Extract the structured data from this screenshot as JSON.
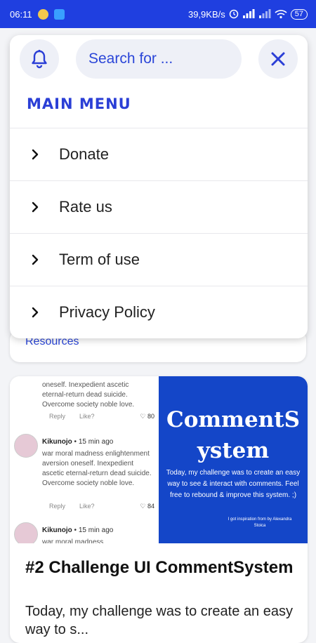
{
  "status_bar": {
    "time": "06:11",
    "network_speed": "39,9KB/s",
    "battery": "57",
    "icons": [
      "app-notification-icon",
      "download-icon",
      "alarm-icon",
      "signal-icon",
      "signal-icon",
      "wifi-icon",
      "battery-icon"
    ]
  },
  "header": {
    "bell_icon": "bell-icon",
    "search": {
      "placeholder": "Search for ..."
    },
    "close_icon": "close-icon"
  },
  "menu": {
    "title": "MAIN MENU",
    "items": [
      {
        "label": "Donate",
        "icon": "chevron-right-icon"
      },
      {
        "label": "Rate us",
        "icon": "chevron-right-icon"
      },
      {
        "label": "Term of use",
        "icon": "chevron-right-icon"
      },
      {
        "label": "Privacy Policy",
        "icon": "chevron-right-icon"
      }
    ]
  },
  "background": {
    "resources_link": "Resources"
  },
  "post": {
    "image": {
      "comments": [
        {
          "text": "oneself. Inexpedient ascetic eternal-return dead suicide. Overcome society noble love.",
          "reply": "Reply",
          "like": "Like?",
          "likes": "80"
        },
        {
          "author": "Kikunojo",
          "time": "15 min ago",
          "text": "war moral madness enlightenment aversion oneself. Inexpedient ascetic eternal-return dead suicide. Overcome society noble love.",
          "reply": "Reply",
          "like": "Like?",
          "likes": "84"
        },
        {
          "author": "Kikunojo",
          "time": "15 min ago",
          "text": "war moral madness"
        }
      ],
      "panel_title": "CommentS ystem",
      "panel_desc": "Today, my challenge was to create an easy way to see & interact with comments. Feel free to rebound & improve this system. ;)",
      "panel_credit": "I got inspiration from by Alexandra Stoica"
    },
    "title": "#2 Challenge UI CommentSystem",
    "excerpt": "Today, my challenge was to create an easy way to s..."
  },
  "colors": {
    "accent": "#2b3fd6",
    "status_bar": "#1f3fe0",
    "panel_blue": "#1446c8"
  }
}
